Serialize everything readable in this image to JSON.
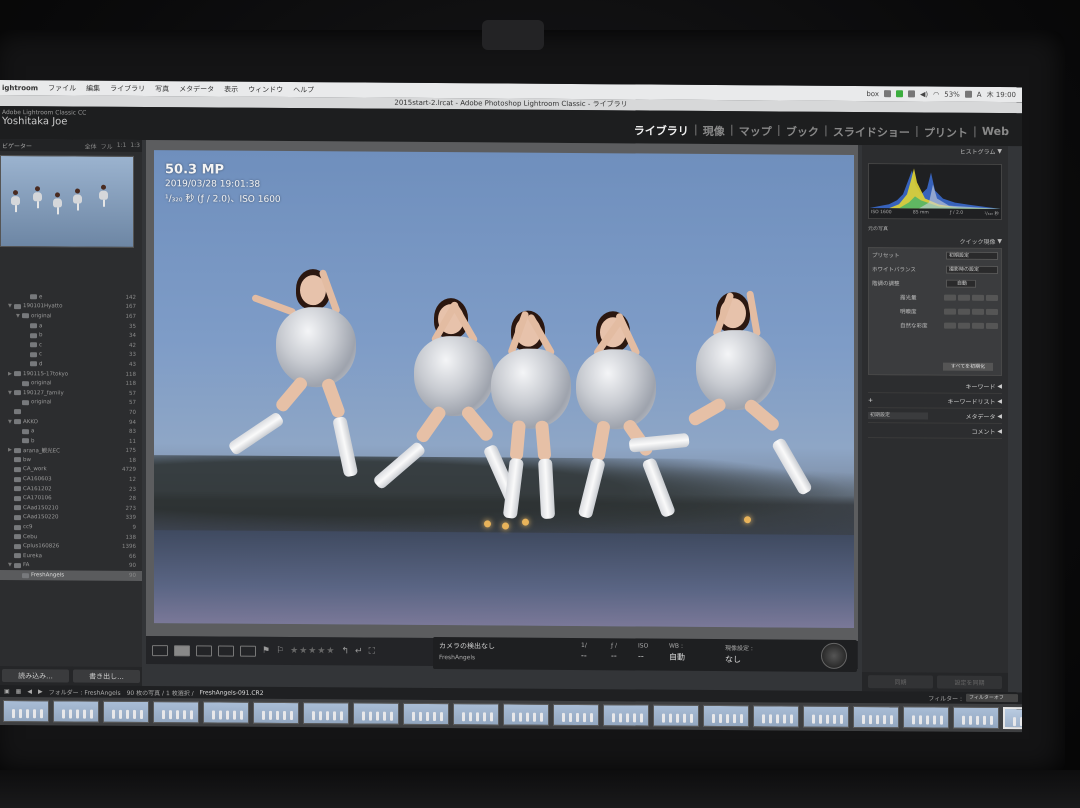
{
  "menubar": {
    "app": "ightroom",
    "items": [
      "ファイル",
      "編集",
      "ライブラリ",
      "写真",
      "メタデータ",
      "表示",
      "ウィンドウ",
      "ヘルプ"
    ],
    "status_left": "box",
    "battery": "53%",
    "input_mode": "A",
    "clock": "木 19:00"
  },
  "window": {
    "title": "2015start-2.lrcat - Adobe Photoshop Lightroom Classic - ライブラリ"
  },
  "identity": {
    "product": "Adobe Lightroom Classic CC",
    "user": "Yoshitaka Joe"
  },
  "modules": [
    {
      "label": "ライブラリ",
      "active": true
    },
    {
      "label": "現像",
      "active": false
    },
    {
      "label": "マップ",
      "active": false
    },
    {
      "label": "ブック",
      "active": false
    },
    {
      "label": "スライドショー",
      "active": false
    },
    {
      "label": "プリント",
      "active": false
    },
    {
      "label": "Web",
      "active": false
    }
  ],
  "navigator": {
    "label": "ビゲーター",
    "zooms": [
      "全体",
      "フル",
      "1:1",
      "1:3"
    ]
  },
  "folders": [
    {
      "indent": 3,
      "tri": "",
      "name": "e",
      "count": "142",
      "selected": false
    },
    {
      "indent": 1,
      "tri": "▼",
      "name": "190101Hyatto",
      "count": "167",
      "selected": false
    },
    {
      "indent": 2,
      "tri": "▼",
      "name": "original",
      "count": "167",
      "selected": false
    },
    {
      "indent": 3,
      "tri": "",
      "name": "a",
      "count": "35",
      "selected": false
    },
    {
      "indent": 3,
      "tri": "",
      "name": "b",
      "count": "34",
      "selected": false
    },
    {
      "indent": 3,
      "tri": "",
      "name": "c",
      "count": "42",
      "selected": false
    },
    {
      "indent": 3,
      "tri": "",
      "name": "c",
      "count": "33",
      "selected": false
    },
    {
      "indent": 3,
      "tri": "",
      "name": "d",
      "count": "43",
      "selected": false
    },
    {
      "indent": 1,
      "tri": "▶",
      "name": "190115-17tokyo",
      "count": "118",
      "selected": false
    },
    {
      "indent": 2,
      "tri": "",
      "name": "original",
      "count": "118",
      "selected": false
    },
    {
      "indent": 1,
      "tri": "▼",
      "name": "190127_family",
      "count": "57",
      "selected": false
    },
    {
      "indent": 2,
      "tri": "",
      "name": "original",
      "count": "57",
      "selected": false
    },
    {
      "indent": 1,
      "tri": "",
      "name": "",
      "count": "70",
      "selected": false
    },
    {
      "indent": 1,
      "tri": "▼",
      "name": "AKKO",
      "count": "94",
      "selected": false
    },
    {
      "indent": 2,
      "tri": "",
      "name": "a",
      "count": "83",
      "selected": false
    },
    {
      "indent": 2,
      "tri": "",
      "name": "b",
      "count": "11",
      "selected": false
    },
    {
      "indent": 1,
      "tri": "▶",
      "name": "arana_観光EC",
      "count": "175",
      "selected": false
    },
    {
      "indent": 1,
      "tri": "",
      "name": "bw",
      "count": "18",
      "selected": false
    },
    {
      "indent": 1,
      "tri": "",
      "name": "CA_work",
      "count": "4729",
      "selected": false
    },
    {
      "indent": 1,
      "tri": "",
      "name": "CA160603",
      "count": "12",
      "selected": false
    },
    {
      "indent": 1,
      "tri": "",
      "name": "CA161202",
      "count": "23",
      "selected": false
    },
    {
      "indent": 1,
      "tri": "",
      "name": "CA170106",
      "count": "28",
      "selected": false
    },
    {
      "indent": 1,
      "tri": "",
      "name": "CAad150210",
      "count": "273",
      "selected": false
    },
    {
      "indent": 1,
      "tri": "",
      "name": "CAad150220",
      "count": "339",
      "selected": false
    },
    {
      "indent": 1,
      "tri": "",
      "name": "cc9",
      "count": "9",
      "selected": false
    },
    {
      "indent": 1,
      "tri": "",
      "name": "Cebu",
      "count": "138",
      "selected": false
    },
    {
      "indent": 1,
      "tri": "",
      "name": "Cplus160826",
      "count": "1396",
      "selected": false
    },
    {
      "indent": 1,
      "tri": "",
      "name": "Eureka",
      "count": "66",
      "selected": false
    },
    {
      "indent": 1,
      "tri": "▼",
      "name": "FA",
      "count": "90",
      "selected": false
    },
    {
      "indent": 2,
      "tri": "",
      "name": "FreshAngels",
      "count": "90",
      "selected": true
    }
  ],
  "left_buttons": {
    "import": "読み込み...",
    "export": "書き出し..."
  },
  "photo_info": {
    "megapixels": "50.3 MP",
    "datetime": "2019/03/28 19:01:38",
    "exposure": "¹/₃₂₀ 秒 (ƒ / 2.0)、ISO 1600"
  },
  "toolbar": {
    "stars": "★★★★★"
  },
  "camera_panel": {
    "camera": "カメラの検出なし",
    "folder": "FreshAngels",
    "shutter_label": "1/",
    "shutter_value": "--",
    "aperture_label": "ƒ /",
    "aperture_value": "--",
    "iso_label": "ISO",
    "iso_value": "--",
    "wb_label": "WB :",
    "wb_value": "自動",
    "dev_label": "現像設定 :",
    "dev_value": "なし"
  },
  "histogram": {
    "label": "ヒストグラム",
    "iso": "ISO 1600",
    "focal": "85 mm",
    "aperture": "ƒ / 2.0",
    "shutter": "¹/₃₂₀ 秒",
    "original": "元の写真"
  },
  "quick_develop": {
    "label": "クイック現像",
    "preset_label": "プリセット",
    "preset_value": "初期設定",
    "wb_label": "ホワイトバランス",
    "wb_value": "撮影時の設定",
    "tone_label": "階調の調整",
    "tone_value": "自動",
    "exposure_label": "露光量",
    "clarity_label": "明瞭度",
    "vibrance_label": "自然な彩度",
    "reset_all": "すべてを初期化"
  },
  "right_sections": {
    "keywording": "キーワード",
    "keyword_list": "キーワードリスト",
    "metadata_preset": "初期設定",
    "metadata": "メタデータ",
    "comments": "コメント"
  },
  "right_buttons": {
    "sync": "同期",
    "sync_settings": "設定を同期"
  },
  "filmstrip": {
    "path": "フォルダー : FreshAngels",
    "count": "90 枚の写真 / 1 枚選択 /",
    "file": "FreshAngels-091.CR2",
    "filter_label": "フィルター :",
    "filter_value": "フィルターオフ",
    "thumb_count": 21
  }
}
